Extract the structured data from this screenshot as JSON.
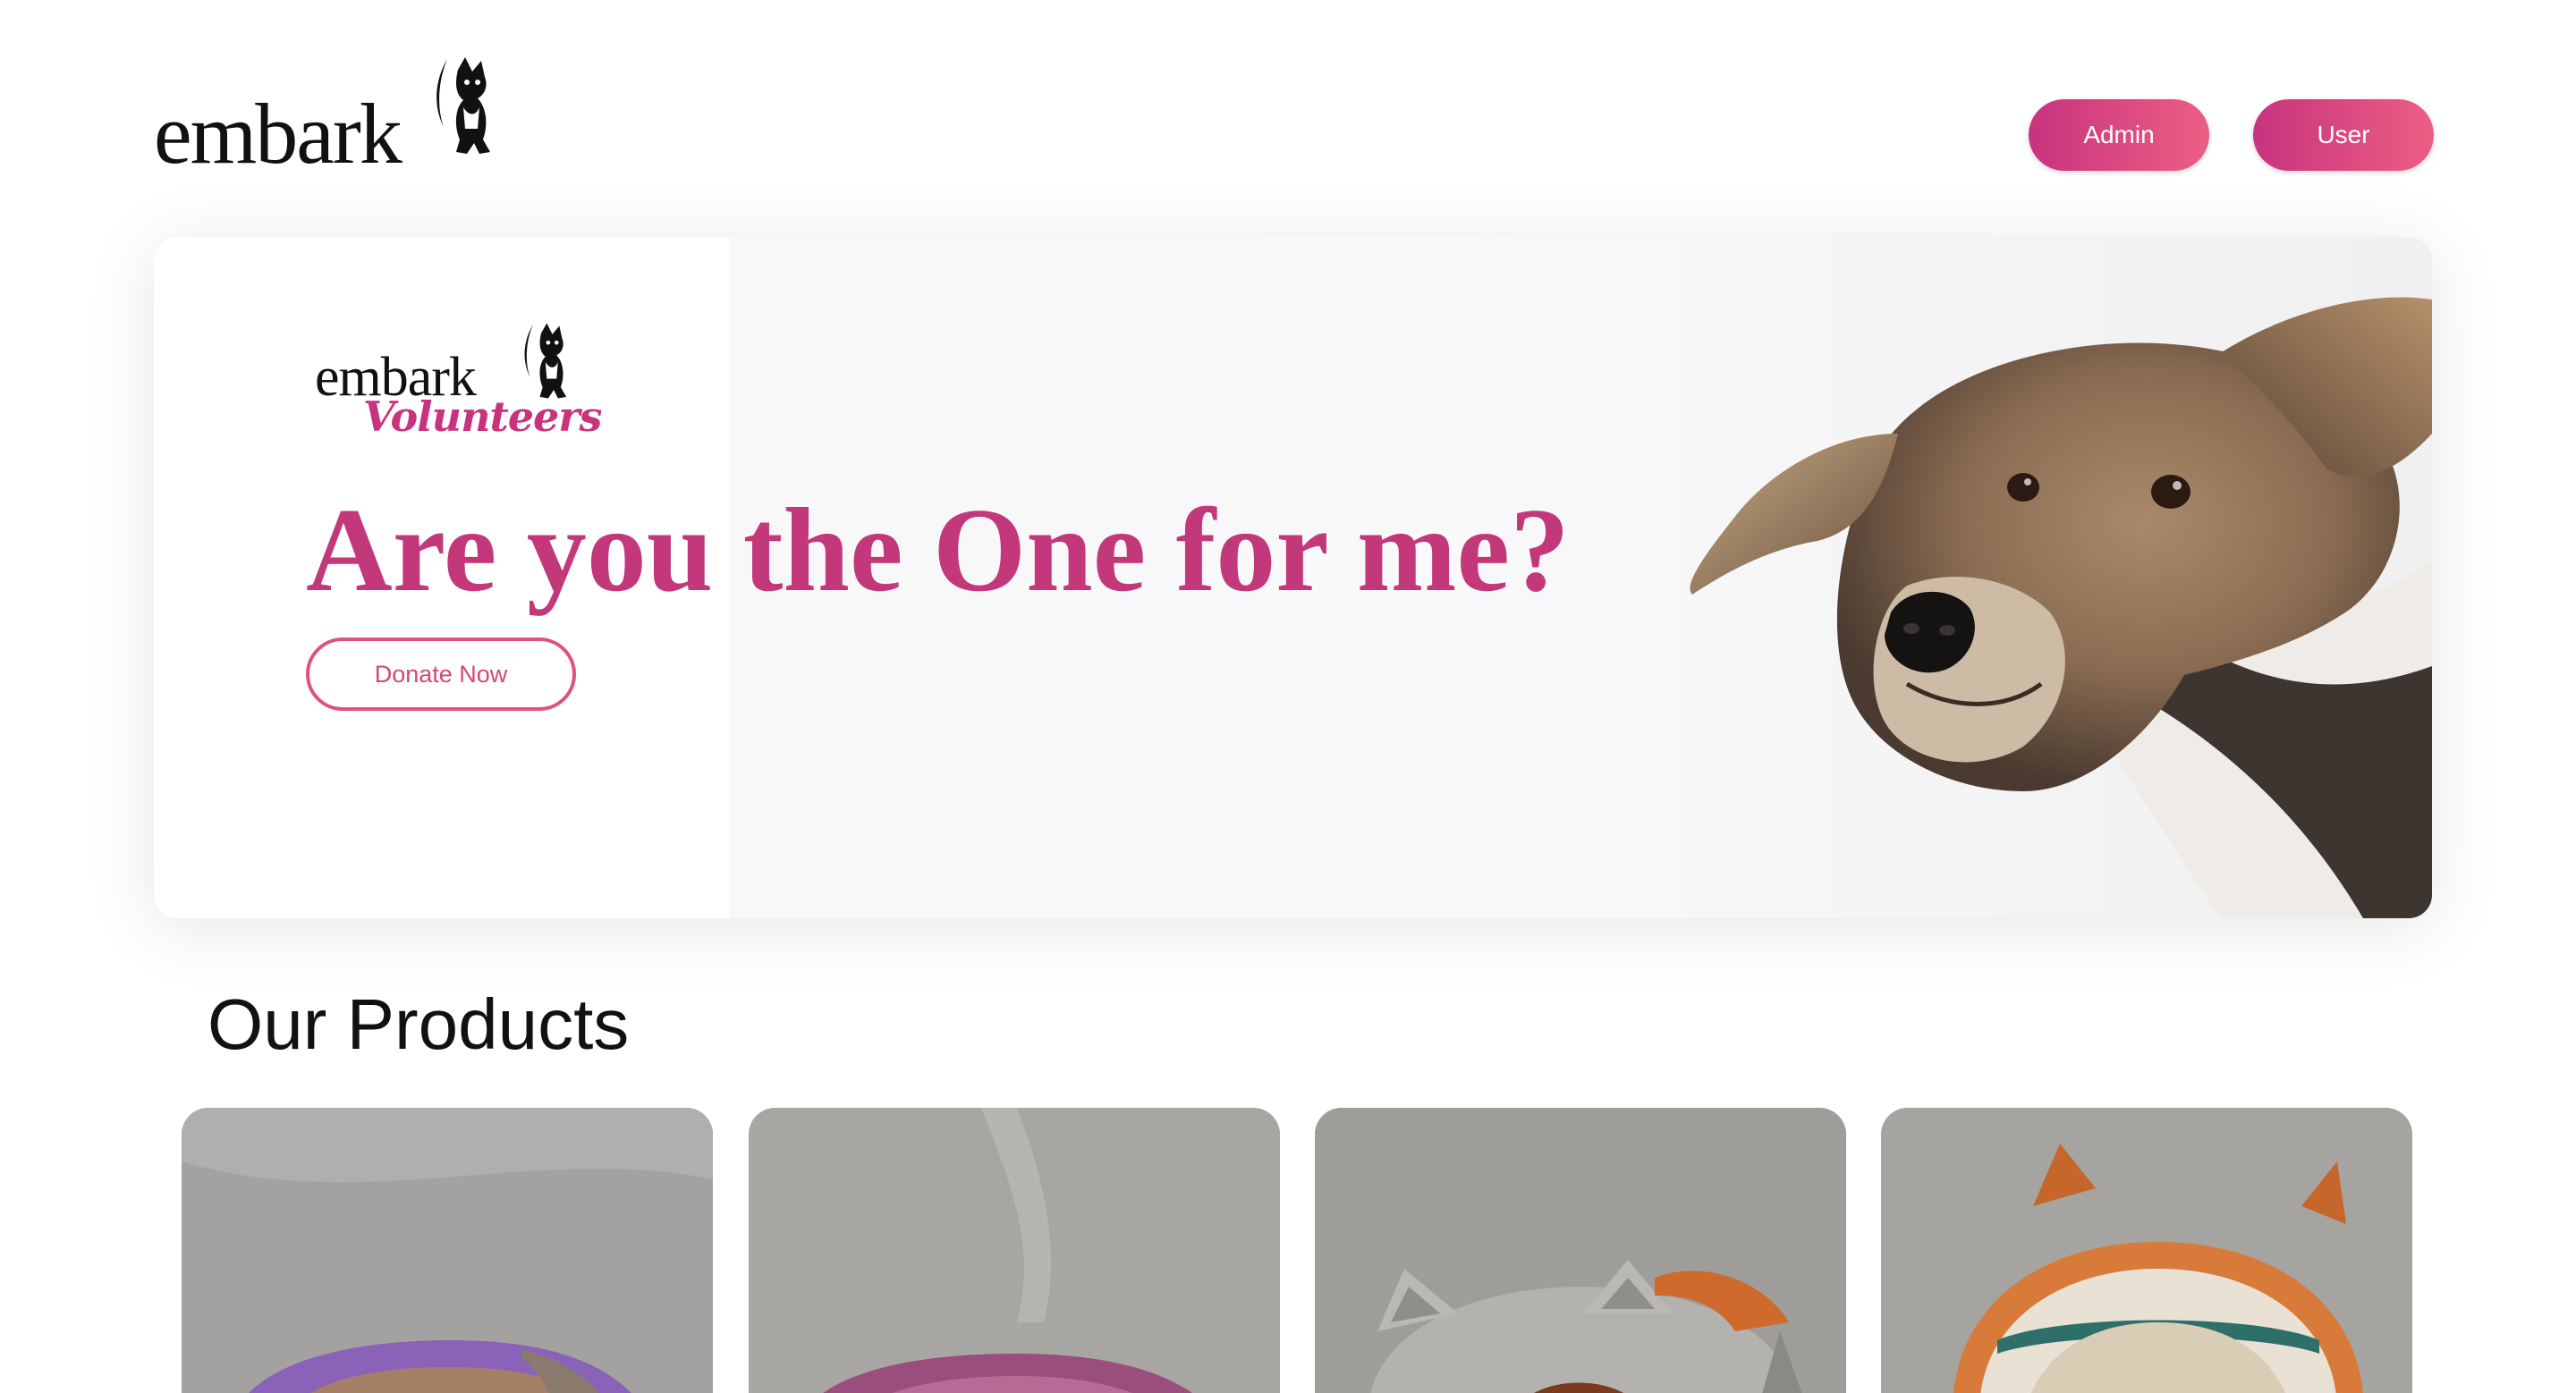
{
  "brand": {
    "logo_text": "embark",
    "volunteers_logo_text": "embark",
    "volunteers_sub": "Volunteers"
  },
  "nav": {
    "admin_label": "Admin",
    "user_label": "User"
  },
  "hero": {
    "title": "Are you the One for me?",
    "cta_label": "Donate Now"
  },
  "products": {
    "section_title": "Our Products",
    "items": [
      {
        "icon": "purple-crochet-ring-bed"
      },
      {
        "icon": "pink-crochet-ring-bed"
      },
      {
        "icon": "grey-cat-crochet-hat"
      },
      {
        "icon": "orange-white-crochet-basket"
      }
    ]
  },
  "colors": {
    "accent": "#c8337e",
    "accent_light": "#ec5f83",
    "hero_title": "#c3387a"
  }
}
